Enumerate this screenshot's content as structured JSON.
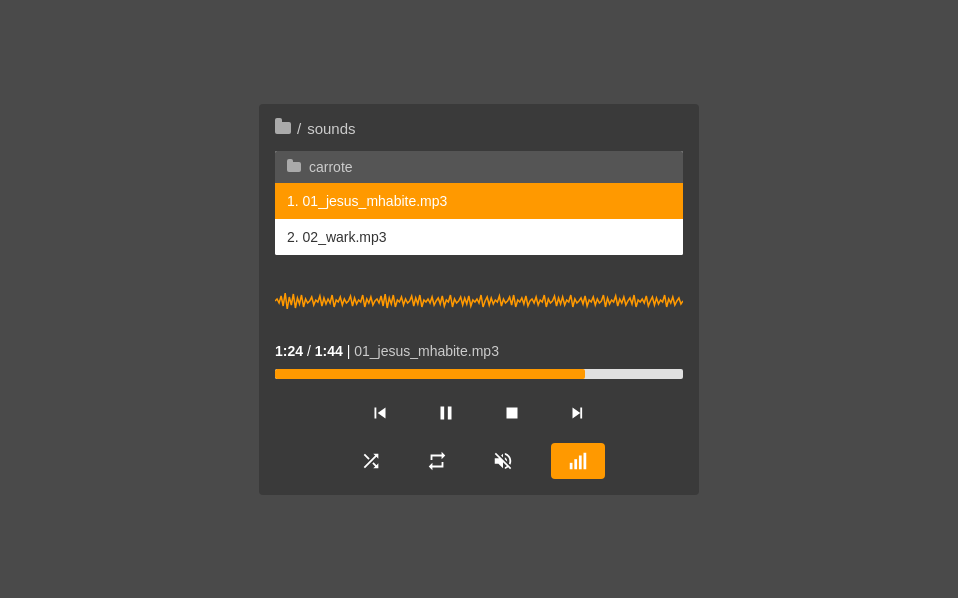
{
  "breadcrumb": {
    "separator": "/",
    "folder": "sounds"
  },
  "fileList": {
    "folderName": "carrote",
    "items": [
      {
        "index": 1,
        "name": "01_jesus_mhabite.mp3",
        "active": true
      },
      {
        "index": 2,
        "name": "02_wark.mp3",
        "active": false
      }
    ]
  },
  "player": {
    "currentTime": "1:24",
    "totalTime": "1:44",
    "trackName": "01_jesus_mhabite.mp3",
    "progressPercent": 76
  },
  "controls": {
    "prev": "⏮",
    "pause": "⏸",
    "stop": "⏹",
    "next": "⏭",
    "shuffle": "shuffle",
    "repeat": "repeat",
    "mute": "mute",
    "volume": "volume"
  }
}
